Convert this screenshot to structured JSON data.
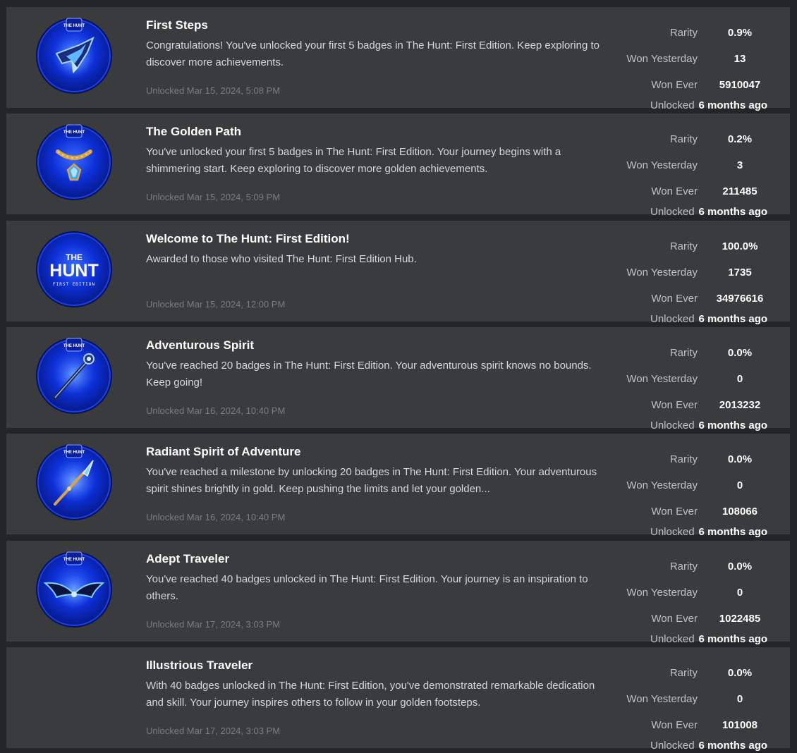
{
  "stat_labels": {
    "rarity": "Rarity",
    "won_yesterday": "Won Yesterday",
    "won_ever": "Won Ever",
    "unlocked": "Unlocked"
  },
  "badges": [
    {
      "title": "First Steps",
      "description": "Congratulations! You've unlocked your first 5 badges in The Hunt: First Edition. Keep exploring to discover more achievements.",
      "unlocked_date": "Unlocked Mar 15, 2024, 5:08 PM",
      "rarity": "0.9%",
      "won_yesterday": "13",
      "won_ever": "5910047",
      "unlocked_ago": "6 months ago",
      "icon": "ice-crystal-icon"
    },
    {
      "title": "The Golden Path",
      "description": "You've unlocked your first 5 badges in The Hunt: First Edition. Your journey begins with a shimmering start. Keep exploring to discover more golden achievements.",
      "unlocked_date": "Unlocked Mar 15, 2024, 5:09 PM",
      "rarity": "0.2%",
      "won_yesterday": "3",
      "won_ever": "211485",
      "unlocked_ago": "6 months ago",
      "icon": "golden-necklace-icon"
    },
    {
      "title": "Welcome to The Hunt: First Edition!",
      "description": "Awarded to those who visited The Hunt: First Edition Hub.",
      "unlocked_date": "Unlocked Mar 15, 2024, 12:00 PM",
      "rarity": "100.0%",
      "won_yesterday": "1735",
      "won_ever": "34976616",
      "unlocked_ago": "6 months ago",
      "icon": "the-hunt-logo-icon",
      "logo_text": {
        "the": "THE",
        "hunt": "HUNT",
        "edition": "FIRST EDITION"
      }
    },
    {
      "title": "Adventurous Spirit",
      "description": "You've reached 20 badges in The Hunt: First Edition. Your adventurous spirit knows no bounds. Keep going!",
      "unlocked_date": "Unlocked Mar 16, 2024, 10:40 PM",
      "rarity": "0.0%",
      "won_yesterday": "0",
      "won_ever": "2013232",
      "unlocked_ago": "6 months ago",
      "icon": "staff-icon"
    },
    {
      "title": "Radiant Spirit of Adventure",
      "description": "You've reached a milestone by unlocking 20 badges in The Hunt: First Edition. Your adventurous spirit shines brightly in gold. Keep pushing the limits and let your golden...",
      "unlocked_date": "Unlocked Mar 16, 2024, 10:40 PM",
      "rarity": "0.0%",
      "won_yesterday": "0",
      "won_ever": "108066",
      "unlocked_ago": "6 months ago",
      "icon": "golden-spear-icon"
    },
    {
      "title": "Adept Traveler",
      "description": "You've reached 40 badges unlocked in The Hunt: First Edition. Your journey is an inspiration to others.",
      "unlocked_date": "Unlocked Mar 17, 2024, 3:03 PM",
      "rarity": "0.0%",
      "won_yesterday": "0",
      "won_ever": "1022485",
      "unlocked_ago": "6 months ago",
      "icon": "wings-icon"
    },
    {
      "title": "Illustrious Traveler",
      "description": "With 40 badges unlocked in The Hunt: First Edition, you've demonstrated remarkable dedication and skill. Your journey inspires others to follow in your golden footsteps.",
      "unlocked_date": "Unlocked Mar 17, 2024, 3:03 PM",
      "rarity": "0.0%",
      "won_yesterday": "0",
      "won_ever": "101008",
      "unlocked_ago": "6 months ago",
      "icon": null
    }
  ],
  "small_tag_text": "THE HUNT",
  "colors": {
    "page_background": "#232527",
    "card_background": "#393b3d",
    "badge_blue": "#0a2ad8",
    "badge_ring": "#0719a0",
    "gold": "#d9a441"
  }
}
